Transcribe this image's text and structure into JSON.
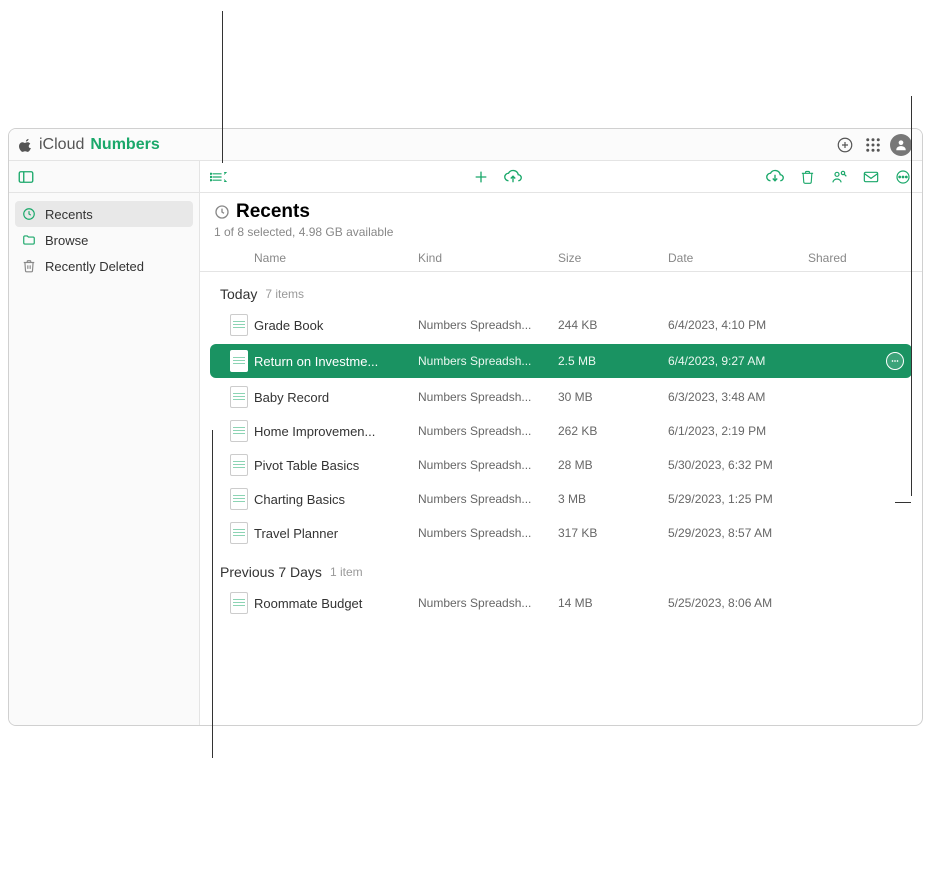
{
  "titlebar": {
    "icloud": "iCloud",
    "numbers": "Numbers"
  },
  "sidebar": {
    "items": [
      {
        "label": "Recents",
        "selected": true,
        "icon": "clock-icon"
      },
      {
        "label": "Browse",
        "selected": false,
        "icon": "folder-icon"
      },
      {
        "label": "Recently Deleted",
        "selected": false,
        "icon": "trash-icon"
      }
    ]
  },
  "header": {
    "title": "Recents",
    "subtitle": "1 of 8 selected, 4.98 GB available"
  },
  "columns": {
    "name": "Name",
    "kind": "Kind",
    "size": "Size",
    "date": "Date",
    "shared": "Shared"
  },
  "groups": [
    {
      "label": "Today",
      "count_label": "7 items",
      "rows": [
        {
          "name": "Grade Book",
          "kind": "Numbers Spreadsh...",
          "size": "244 KB",
          "date": "6/4/2023, 4:10 PM",
          "selected": false
        },
        {
          "name": "Return on Investme...",
          "kind": "Numbers Spreadsh...",
          "size": "2.5 MB",
          "date": "6/4/2023, 9:27 AM",
          "selected": true
        },
        {
          "name": "Baby Record",
          "kind": "Numbers Spreadsh...",
          "size": "30 MB",
          "date": "6/3/2023, 3:48 AM",
          "selected": false
        },
        {
          "name": "Home Improvemen...",
          "kind": "Numbers Spreadsh...",
          "size": "262 KB",
          "date": "6/1/2023, 2:19 PM",
          "selected": false
        },
        {
          "name": "Pivot Table Basics",
          "kind": "Numbers Spreadsh...",
          "size": "28 MB",
          "date": "5/30/2023, 6:32 PM",
          "selected": false
        },
        {
          "name": "Charting Basics",
          "kind": "Numbers Spreadsh...",
          "size": "3 MB",
          "date": "5/29/2023, 1:25 PM",
          "selected": false
        },
        {
          "name": "Travel Planner",
          "kind": "Numbers Spreadsh...",
          "size": "317 KB",
          "date": "5/29/2023, 8:57 AM",
          "selected": false
        }
      ]
    },
    {
      "label": "Previous 7 Days",
      "count_label": "1 item",
      "rows": [
        {
          "name": "Roommate Budget",
          "kind": "Numbers Spreadsh...",
          "size": "14 MB",
          "date": "5/25/2023, 8:06 AM",
          "selected": false
        }
      ]
    }
  ]
}
